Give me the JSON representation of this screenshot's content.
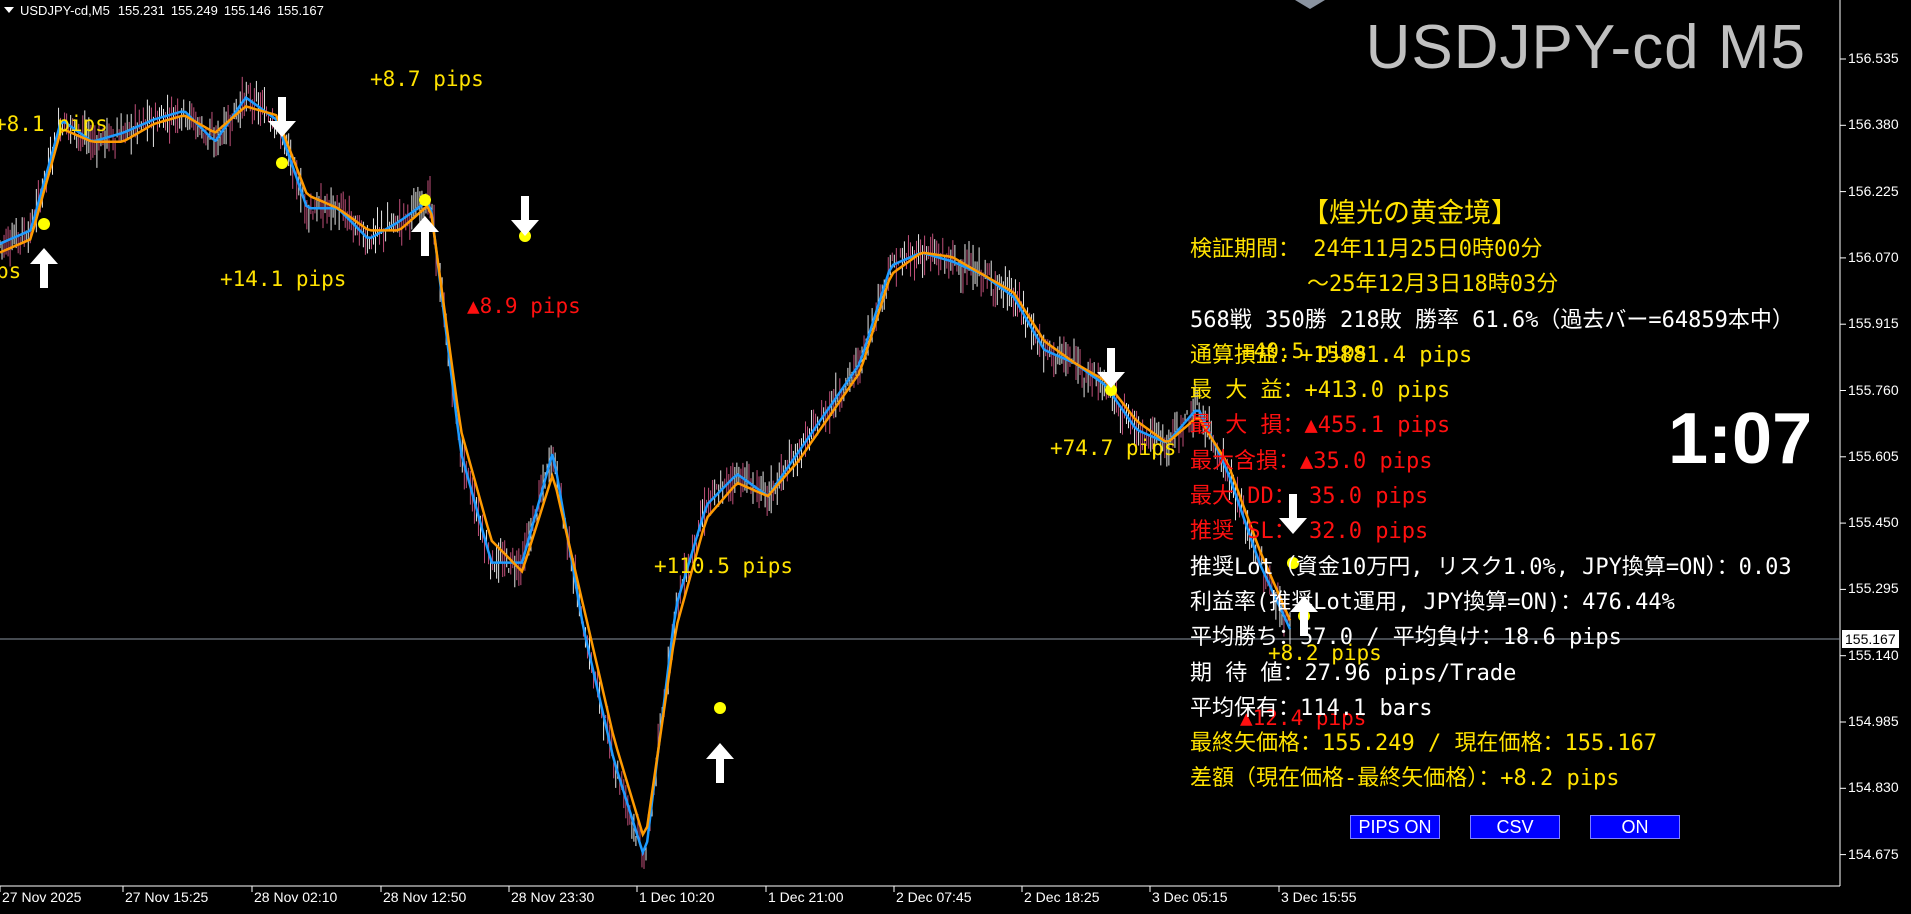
{
  "header": {
    "symbol": "USDJPY-cd,M5",
    "quotes": [
      "155.231",
      "155.249",
      "155.146",
      "155.167"
    ]
  },
  "big_title": "USDJPY-cd M5",
  "clock": "1:07",
  "info": {
    "title": "【煌光の黄金境】",
    "lines": [
      {
        "text": "検証期間： 24年11月25日0時00分",
        "color": "yellow"
      },
      {
        "text": "～25年12月3日18時03分",
        "color": "yellow",
        "indent": true
      },
      {
        "text": "568戦 350勝 218敗 勝率 61.6%（過去バー=64859本中）",
        "color": "white"
      },
      {
        "text": "通算損益：+15881.4 pips",
        "color": "yellow"
      },
      {
        "text": "最 大 益：+413.0 pips",
        "color": "yellow"
      },
      {
        "text": "最 大 損：▲455.1 pips",
        "color": "red"
      },
      {
        "text": "最大含損：▲35.0 pips",
        "color": "red"
      },
      {
        "text": "最大 DD： 35.0 pips",
        "color": "red"
      },
      {
        "text": "推奨 SL： 32.0 pips",
        "color": "red"
      },
      {
        "text": "推奨Lot（資金10万円, リスク1.0%, JPY換算=ON）：0.03",
        "color": "white"
      },
      {
        "text": "利益率(推奨Lot運用, JPY換算=ON)：476.44%",
        "color": "white"
      },
      {
        "text": "平均勝ち：57.0 / 平均負け：18.6 pips",
        "color": "white"
      },
      {
        "text": "期 待 値：27.96 pips/Trade",
        "color": "white"
      },
      {
        "text": "平均保有：114.1 bars",
        "color": "white"
      },
      {
        "text": "最終矢価格：155.249 / 現在価格：155.167",
        "color": "yellow"
      },
      {
        "text": "差額（現在価格-最終矢価格）：+8.2 pips",
        "color": "yellow"
      }
    ]
  },
  "buttons": [
    {
      "label": "PIPS ON"
    },
    {
      "label": "CSV"
    },
    {
      "label": "ON"
    }
  ],
  "price_axis": [
    "156.535",
    "156.380",
    "156.225",
    "156.070",
    "155.915",
    "155.760",
    "155.605",
    "155.450",
    "155.295",
    "155.140",
    "154.985",
    "154.830",
    "154.675"
  ],
  "current_price": "155.167",
  "time_axis": [
    "27 Nov 2025",
    "27 Nov 15:25",
    "28 Nov 02:10",
    "28 Nov 12:50",
    "28 Nov 23:30",
    "1 Dec 10:20",
    "1 Dec 21:00",
    "2 Dec 07:45",
    "2 Dec 18:25",
    "3 Dec 05:15",
    "3 Dec 15:55"
  ],
  "pip_labels": [
    {
      "text": "+8.1 pips",
      "color": "#ffe200"
    },
    {
      "text": "ps",
      "color": "#ffe200"
    },
    {
      "text": "+8.7 pips",
      "color": "#ffe200"
    },
    {
      "text": "+14.1 pips",
      "color": "#ffe200"
    },
    {
      "text": "▲8.9 pips",
      "color": "#ff1010"
    },
    {
      "text": "+110.5 pips",
      "color": "#ffe200"
    },
    {
      "text": "+40.5 pips",
      "color": "#ffe200"
    },
    {
      "text": "+74.7 pips",
      "color": "#ffe200"
    },
    {
      "text": "+8.2 pips",
      "color": "#ffe200"
    },
    {
      "text": "▲12.4 pips",
      "color": "#ff1010"
    }
  ],
  "colors": {
    "background": "#000000",
    "fast_line": "#1e9bff",
    "slow_line": "#ff9a00",
    "marker": "#ffff00",
    "button": "#0000ff"
  },
  "chart_data": {
    "type": "line",
    "title": "USDJPY-cd M5",
    "ylim": [
      154.62,
      156.62
    ],
    "x": [
      "27 Nov 2025",
      "27 Nov 15:25",
      "28 Nov 02:10",
      "28 Nov 12:50",
      "28 Nov 23:30",
      "1 Dec 10:20",
      "1 Dec 21:00",
      "2 Dec 07:45",
      "2 Dec 18:25",
      "3 Dec 05:15",
      "3 Dec 15:55"
    ],
    "series": [
      {
        "values": [
          156.07,
          156.1,
          156.35,
          156.3,
          156.32,
          156.35,
          156.37,
          156.3,
          156.4,
          156.35,
          156.15,
          156.15,
          156.08,
          156.12,
          156.17,
          155.6,
          155.35,
          155.35,
          155.6,
          155.2,
          154.9,
          154.68,
          155.25,
          155.48,
          155.55,
          155.5,
          155.6,
          155.7,
          155.8,
          156.02,
          156.05,
          156.03,
          156.0,
          155.95,
          155.83,
          155.8,
          155.75,
          155.65,
          155.62,
          155.7,
          155.55,
          155.35,
          155.2
        ]
      },
      {
        "values": [
          156.05,
          156.08,
          156.33,
          156.3,
          156.3,
          156.34,
          156.36,
          156.32,
          156.38,
          156.36,
          156.18,
          156.15,
          156.1,
          156.1,
          156.16,
          155.65,
          155.4,
          155.33,
          155.55,
          155.25,
          154.95,
          154.72,
          155.2,
          155.45,
          155.53,
          155.5,
          155.58,
          155.68,
          155.78,
          156.0,
          156.05,
          156.04,
          156.0,
          155.96,
          155.85,
          155.8,
          155.76,
          155.67,
          155.62,
          155.68,
          155.57,
          155.38,
          155.22
        ]
      }
    ]
  }
}
